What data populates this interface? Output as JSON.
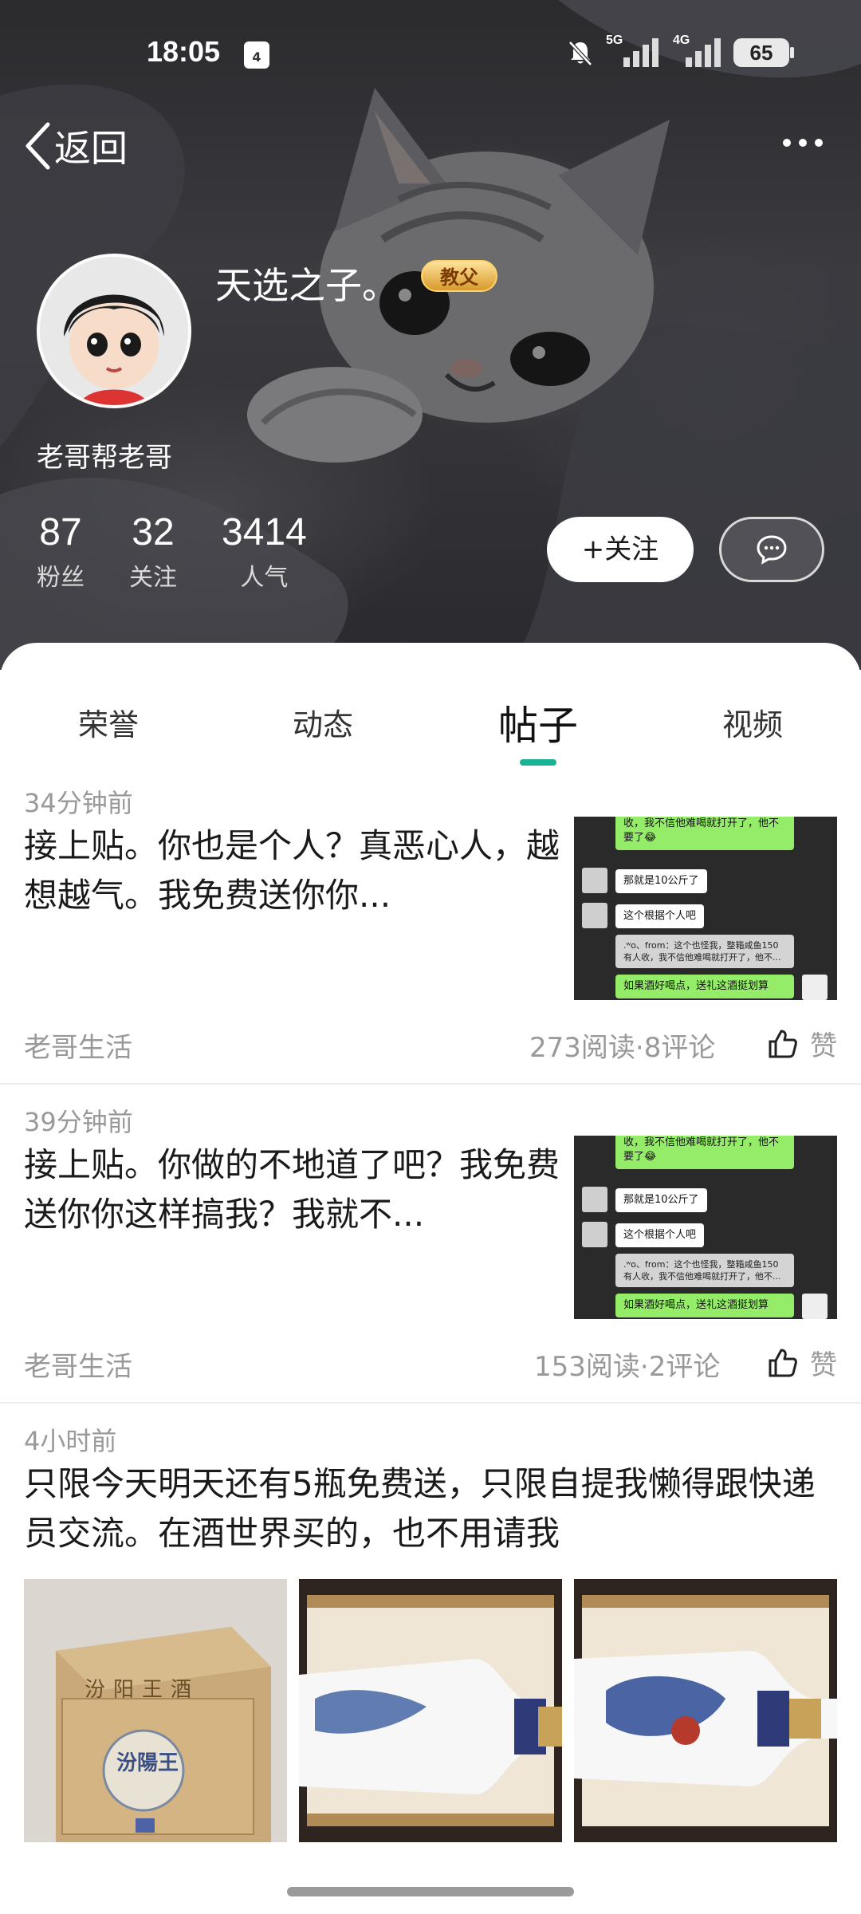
{
  "status_bar": {
    "time": "18:05",
    "notification_count": "4",
    "network_1": "5G",
    "network_2": "4G",
    "battery": "65"
  },
  "nav": {
    "back_label": "返回"
  },
  "profile": {
    "username": "天选之子。",
    "badge": "教父",
    "signature": "老哥帮老哥",
    "stats": [
      {
        "value": "87",
        "label": "粉丝"
      },
      {
        "value": "32",
        "label": "关注"
      },
      {
        "value": "3414",
        "label": "人气"
      }
    ],
    "follow_label": "+关注"
  },
  "tabs": [
    {
      "label": "荣誉",
      "active": false
    },
    {
      "label": "动态",
      "active": false
    },
    {
      "label": "帖子",
      "active": true
    },
    {
      "label": "视频",
      "active": false
    }
  ],
  "posts": [
    {
      "time": "34分钟前",
      "title": "接上贴。你也是个人？真恶心人，越想越气。我免费送你你...",
      "source": "老哥生活",
      "meta": "273阅读·8评论",
      "like": "赞",
      "chat": [
        "收，我不信他难喝就打开了，他不要了😂",
        "那就是10公斤了",
        "这个根据个人吧",
        ".ʷo、from：这个也怪我，整箱咸鱼150有人收，我不信他难喝就打开了，他不...",
        "如果酒好喝点，送礼这酒挺划算"
      ]
    },
    {
      "time": "39分钟前",
      "title": "接上贴。你做的不地道了吧？我免费送你你这样搞我？我就不...",
      "source": "老哥生活",
      "meta": "153阅读·2评论",
      "like": "赞",
      "chat": [
        "收，我不信他难喝就打开了，他不要了😂",
        "那就是10公斤了",
        "这个根据个人吧",
        ".ʷo、from：这个也怪我，整箱咸鱼150有人收，我不信他难喝就打开了，他不...",
        "如果酒好喝点，送礼这酒挺划算"
      ]
    },
    {
      "time": "4小时前",
      "title": "只限今天明天还有5瓶免费送，只限自提我懒得跟快递员交流。在酒世界买的，也不用请我",
      "box_label": "汾阳王酒",
      "box_brand": "汾陽王"
    }
  ]
}
